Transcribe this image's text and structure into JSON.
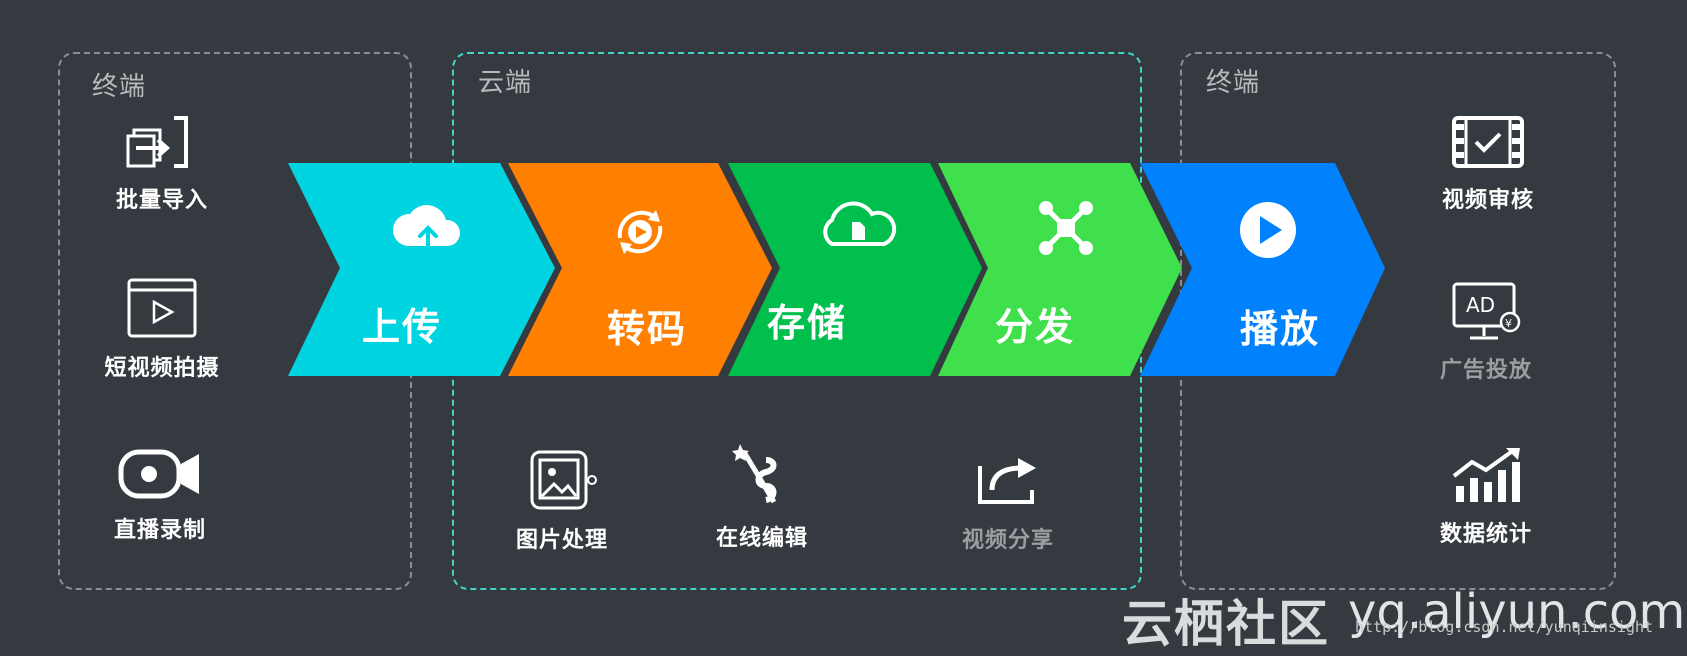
{
  "panels": {
    "left_title": "终端",
    "middle_title": "云端",
    "right_title": "终端"
  },
  "stages": [
    {
      "label": "上传",
      "color": "#00d4e0",
      "icon": "cloud-upload-icon"
    },
    {
      "label": "转码",
      "color": "#ff7f00",
      "icon": "transcode-play-icon"
    },
    {
      "label": "存储",
      "color": "#00bf4c",
      "icon": "cloud-storage-icon"
    },
    {
      "label": "分发",
      "color": "#3fe04c",
      "icon": "distribute-nodes-icon"
    },
    {
      "label": "播放",
      "color": "#0082ff",
      "icon": "play-circle-icon"
    }
  ],
  "left_features": [
    {
      "label": "批量导入",
      "icon": "batch-import-icon"
    },
    {
      "label": "短视频拍摄",
      "icon": "short-video-shoot-icon"
    },
    {
      "label": "直播录制",
      "icon": "camera-record-icon"
    }
  ],
  "cloud_features": [
    {
      "label": "图片处理",
      "icon": "image-processing-icon"
    },
    {
      "label": "在线编辑",
      "icon": "magic-wand-film-icon"
    },
    {
      "label": "视频分享",
      "icon": "share-arrow-icon"
    }
  ],
  "right_features": [
    {
      "label": "视频审核",
      "icon": "film-check-icon"
    },
    {
      "label": "广告投放",
      "icon": "ad-monitor-icon"
    },
    {
      "label": "数据统计",
      "icon": "bar-chart-trend-icon"
    }
  ],
  "watermark": {
    "brand_cn": "云栖社区",
    "brand_url": "yq.aliyun.com",
    "source_url": "http://blog.csdn.net/yunqiinsight"
  }
}
